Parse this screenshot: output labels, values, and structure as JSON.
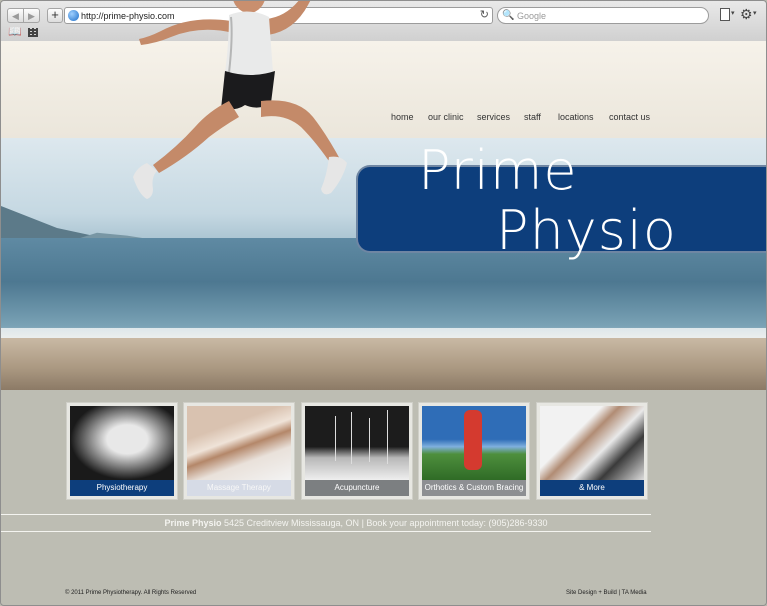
{
  "browser": {
    "url": "http://prime-physio.com",
    "search_placeholder": "Google",
    "back_glyph": "◀",
    "forward_glyph": "▶",
    "add_glyph": "+",
    "reload_glyph": "↻",
    "search_glyph": "🔍",
    "gear_glyph": "⚙",
    "caret_glyph": "▾",
    "bookmarks_glyph": "📖"
  },
  "nav": {
    "items": [
      {
        "label": "home"
      },
      {
        "label": "our clinic"
      },
      {
        "label": "services"
      },
      {
        "label": "staff"
      },
      {
        "label": "locations"
      },
      {
        "label": "contact us"
      }
    ]
  },
  "logo": {
    "word1": "Prime",
    "word2": "Physio"
  },
  "tiles": [
    {
      "label": "Physiotherapy",
      "label_bg": "#0d3e7c"
    },
    {
      "label": "Massage Therapy",
      "label_bg": "#d6dbe6"
    },
    {
      "label": "Acupuncture",
      "label_bg": "#7c7f81"
    },
    {
      "label": "Orthotics & Custom Bracing",
      "label_bg": "#8d8f92"
    },
    {
      "label": "& More",
      "label_bg": "#0d3e7c"
    }
  ],
  "footer": {
    "brand": "Prime Physio",
    "address": "5425 Creditview Mississauga, ON",
    "separator": "|",
    "booking": "Book your appointment today: (905)286-9330",
    "copyright": "© 2011 Prime Physiotherapy. All Rights Reserved",
    "credit": "Site Design + Build | TA Media"
  },
  "colors": {
    "brand_blue": "#0d3e7c",
    "background": "#bdbdb3"
  }
}
